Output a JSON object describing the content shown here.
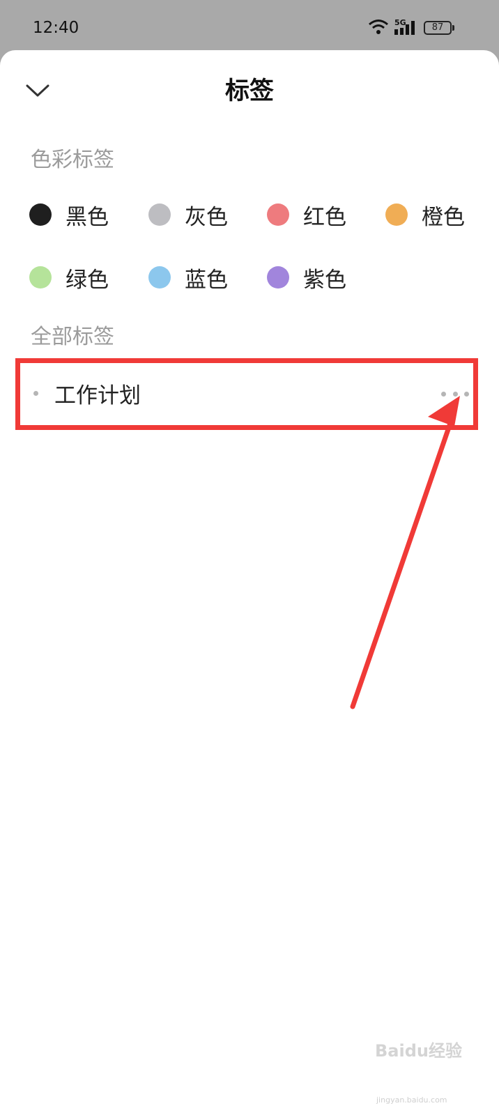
{
  "status": {
    "time": "12:40",
    "network": "5G",
    "battery": "87"
  },
  "header": {
    "title": "标签",
    "collapse_icon": "chevron-down-icon"
  },
  "color_section": {
    "title": "色彩标签",
    "tags": [
      {
        "label": "黑色",
        "color": "#1f1f1f"
      },
      {
        "label": "灰色",
        "color": "#bdbdc1"
      },
      {
        "label": "红色",
        "color": "#ee7b7e"
      },
      {
        "label": "橙色",
        "color": "#f0ad55"
      },
      {
        "label": "绿色",
        "color": "#b5e39a"
      },
      {
        "label": "蓝色",
        "color": "#8cc7ed"
      },
      {
        "label": "紫色",
        "color": "#a185dc"
      }
    ]
  },
  "all_section": {
    "title": "全部标签",
    "tags": [
      {
        "label": "工作计划",
        "more_icon": "more-horizontal-icon"
      }
    ]
  },
  "annotation": {
    "color": "#f03a37"
  },
  "watermark": {
    "text": "Baidu经验",
    "sub": "jingyan.baidu.com"
  }
}
